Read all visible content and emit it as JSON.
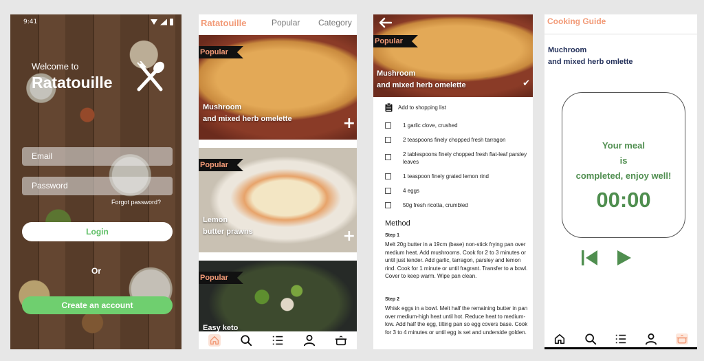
{
  "welcome": {
    "status_time": "9:41",
    "welcome_small": "Welcome to",
    "app_name": "Ratatouille",
    "email_placeholder": "Email",
    "password_placeholder": "Password",
    "forgot_password": "Forgot password?",
    "login": "Login",
    "or": "Or",
    "create_account": "Create an account"
  },
  "feed": {
    "app_title": "Ratatouille",
    "tabs": [
      "Popular",
      "Category"
    ],
    "cards": [
      {
        "badge": "Popular",
        "title_line1": "Mushroom",
        "title_line2": "and mixed herb omelette"
      },
      {
        "badge": "Popular",
        "title_line1": "Lemon",
        "title_line2": "butter prawns"
      },
      {
        "badge": "Popular",
        "title_line1": "Easy keto",
        "title_line2": ""
      }
    ]
  },
  "recipe": {
    "badge": "Popular",
    "title_line1": "Mushroom",
    "title_line2": "and mixed herb omelette",
    "shopping_label": "Add to shopping list",
    "ingredients": [
      "1 garlic clove, crushed",
      "2 teaspoons finely chopped fresh tarragon",
      "2 tablespoons finely chopped fresh flat-leaf parsley leaves",
      "1 teaspoon finely grated lemon rind",
      "4 eggs",
      "50g fresh ricotta, crumbled"
    ],
    "method_title": "Method",
    "steps": [
      {
        "label": "Step 1",
        "text": "Melt 20g butter in a 19cm (base) non-stick frying pan over medium heat. Add mushrooms. Cook for 2 to 3 minutes or until just tender. Add garlic, tarragon, parsley and lemon rind. Cook for 1 minute or until fragrant. Transfer to a bowl. Cover to keep warm. Wipe pan clean."
      },
      {
        "label": "Step 2",
        "text": "Whisk eggs in a bowl. Melt half the remaining butter  in pan over medium-high heat until hot. Reduce heat to medium-low. Add half the egg, tilting pan so egg covers base. Cook for 3 to 4 minutes or until egg is set and underside golden."
      }
    ]
  },
  "guide": {
    "title": "Cooking Guide",
    "recipe_line1": "Muchroom",
    "recipe_line2": "and mixed herb omlette",
    "done_line1": "Your meal",
    "done_line2": "is",
    "done_line3": "completed, enjoy well!",
    "timer": "00:00"
  },
  "nav_icons": [
    "home-icon",
    "search-icon",
    "list-icon",
    "profile-icon",
    "cooking-pot-icon"
  ],
  "colors": {
    "accent": "#f29a77",
    "green": "#6fcf6f",
    "timer_green": "#4f8e4f",
    "navy": "#23305a"
  }
}
